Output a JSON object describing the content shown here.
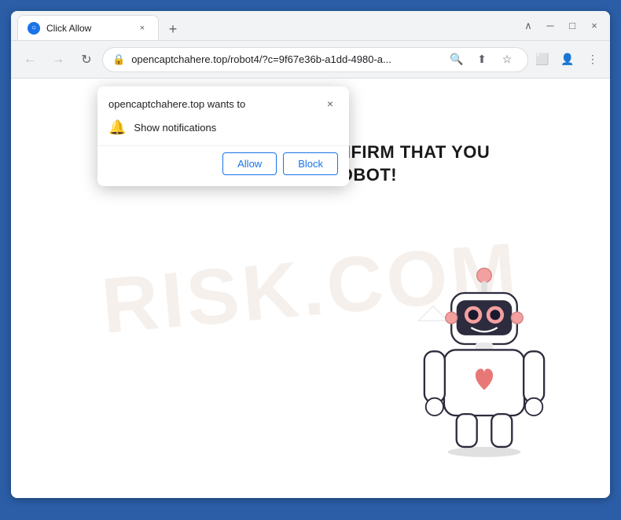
{
  "browser": {
    "tab_title": "Click Allow",
    "favicon_letter": "○",
    "close_btn": "×",
    "new_tab_btn": "+",
    "ctrl_minimize": "─",
    "ctrl_restore": "□",
    "ctrl_close": "×",
    "nav_back": "←",
    "nav_forward": "→",
    "nav_refresh": "↻",
    "url": "opencaptchahere.top/robot4/?c=9f67e36b-a1dd-4980-a...",
    "search_icon": "🔍",
    "share_icon": "⬆",
    "bookmark_icon": "☆",
    "extensions_icon": "⬜",
    "profile_icon": "👤",
    "menu_icon": "⋮"
  },
  "popup": {
    "site_wants": "opencaptchahere.top wants to",
    "notification_label": "Show notifications",
    "allow_btn": "Allow",
    "block_btn": "Block",
    "close_btn": "×"
  },
  "page": {
    "captcha_line1": "CLICK «ALLOW» TO CONFIRM THAT YOU",
    "captcha_line2": "ARE NOT A ROBOT!"
  },
  "watermark": {
    "text": "RISK.COM"
  },
  "colors": {
    "browser_border": "#2b5ea7",
    "allow_color": "#1a73e8",
    "block_color": "#1a73e8"
  }
}
